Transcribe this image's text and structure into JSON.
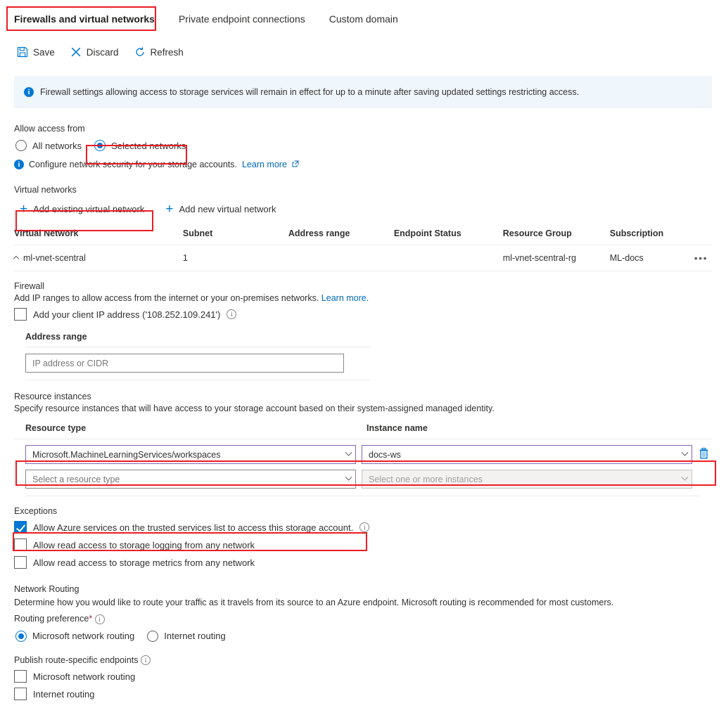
{
  "tabs": [
    {
      "label": "Firewalls and virtual networks",
      "active": true,
      "annotated": true
    },
    {
      "label": "Private endpoint connections",
      "active": false,
      "annotated": false
    },
    {
      "label": "Custom domain",
      "active": false,
      "annotated": false
    }
  ],
  "toolbar": {
    "save_label": "Save",
    "discard_label": "Discard",
    "refresh_label": "Refresh"
  },
  "banner": {
    "icon": "info-icon",
    "text": "Firewall settings allowing access to storage services will remain in effect for up to a minute after saving updated settings restricting access."
  },
  "allow_access": {
    "label": "Allow access from",
    "options": [
      {
        "label": "All networks",
        "selected": false
      },
      {
        "label": "Selected networks",
        "selected": true
      }
    ],
    "note_text": "Configure network security for your storage accounts.",
    "note_link": "Learn more"
  },
  "virtual_networks": {
    "label": "Virtual networks",
    "add_existing_label": "Add existing virtual network",
    "add_new_label": "Add new virtual network",
    "columns": [
      "Virtual Network",
      "Subnet",
      "Address range",
      "Endpoint Status",
      "Resource Group",
      "Subscription"
    ],
    "rows": [
      {
        "virtual_network": "ml-vnet-scentral",
        "subnet": "1",
        "address_range": "",
        "endpoint_status": "",
        "resource_group": "ml-vnet-scentral-rg",
        "subscription": "ML-docs",
        "menu": "•••"
      }
    ]
  },
  "firewall": {
    "label": "Firewall",
    "description": "Add IP ranges to allow access from the internet or your on-premises networks.",
    "description_link": "Learn more.",
    "client_ip_checkbox": {
      "label": "Add your client IP address ('108.252.109.241')",
      "checked": false
    },
    "address_range_label": "Address range",
    "address_range_placeholder": "IP address or CIDR",
    "address_range_value": ""
  },
  "resource_instances": {
    "label": "Resource instances",
    "description": "Specify resource instances that will have access to your storage account based on their system-assigned managed identity.",
    "col_resource_type": "Resource type",
    "col_instance_name": "Instance name",
    "rows": [
      {
        "resource_type": "Microsoft.MachineLearningServices/workspaces",
        "instance_name": "docs-ws",
        "filled": true,
        "delete_icon": "trash-icon"
      },
      {
        "resource_type_placeholder": "Select a resource type",
        "instance_name_placeholder": "Select one or more instances",
        "filled": false
      }
    ]
  },
  "exceptions": {
    "label": "Exceptions",
    "items": [
      {
        "label": "Allow Azure services on the trusted services list to access this storage account.",
        "checked": true,
        "has_info": true
      },
      {
        "label": "Allow read access to storage logging from any network",
        "checked": false,
        "has_info": false
      },
      {
        "label": "Allow read access to storage metrics from any network",
        "checked": false,
        "has_info": false
      }
    ]
  },
  "network_routing": {
    "label": "Network Routing",
    "description": "Determine how you would like to route your traffic as it travels from its source to an Azure endpoint. Microsoft routing is recommended for most customers.",
    "routing_preference_label": "Routing preference",
    "required_mark": "*",
    "routing_options": [
      {
        "label": "Microsoft network routing",
        "selected": true
      },
      {
        "label": "Internet routing",
        "selected": false
      }
    ],
    "publish_label": "Publish route-specific endpoints",
    "publish_options": [
      {
        "label": "Microsoft network routing",
        "checked": false
      },
      {
        "label": "Internet routing",
        "checked": false
      }
    ]
  },
  "colors": {
    "accent": "#0078D4",
    "annotation": "#ED1C24",
    "link": "#0067B8",
    "banner_bg": "#EFF6FC",
    "filled_select_border": "#8764B8"
  }
}
